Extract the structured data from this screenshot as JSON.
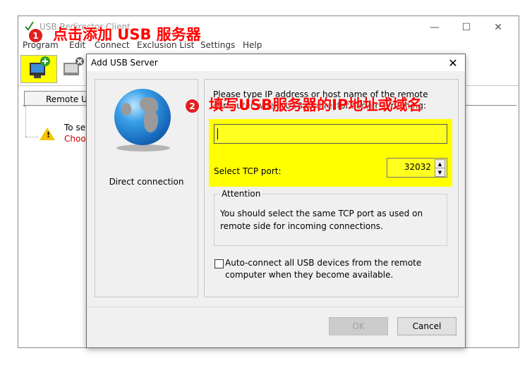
{
  "app": {
    "title": "USB Redirector Client",
    "menu": [
      "Program",
      "Edit",
      "Connect",
      "Exclusion List",
      "Settings",
      "Help"
    ],
    "window_controls": {
      "minimize": "—",
      "maximize": "☐",
      "close": "✕"
    }
  },
  "tree": {
    "tab_label": "Remote U",
    "item_line1": "To se",
    "item_line2": "Choo"
  },
  "dialog": {
    "title": "Add USB Server",
    "close": "✕",
    "left_label": "Direct connection",
    "instructions": "Please type IP address or host name of the remote computer where USB Redirector server is running:",
    "host_value": "",
    "port_label": "Select TCP port:",
    "port_value": "32032",
    "attention_title": "Attention",
    "attention_text": "You should select the same TCP port as used on remote side for incoming connections.",
    "autoconnect_label": "Auto-connect all USB devices from the remote computer when they become available.",
    "ok_label": "OK",
    "cancel_label": "Cancel"
  },
  "annotations": {
    "step1_number": "1",
    "step1_text": "点击添加 USB 服务器",
    "step2_number": "2",
    "step2_text": "填写USB服务器的IP地址或域名"
  },
  "colors": {
    "highlight": "#ffff00",
    "annotation": "#ff0000"
  }
}
